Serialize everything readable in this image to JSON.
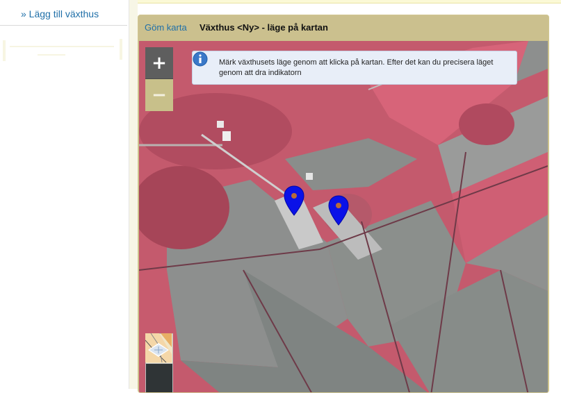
{
  "sidebar": {
    "add_link": "» Lägg till växthus"
  },
  "panel": {
    "hide_map_link": "Göm karta",
    "title": "Växthus <Ny> - läge på kartan"
  },
  "map": {
    "info_text": "Märk växthusets läge genom att klicka på kartan. Efter det kan du precisera läget genom att dra indikatorn",
    "zoom_in_label": "+",
    "zoom_out_label": "−",
    "info_icon": "info-icon",
    "marker_color": "#0a11e8",
    "markers": [
      {
        "name": "greenhouse-marker-1"
      },
      {
        "name": "greenhouse-marker-2"
      }
    ]
  },
  "colors": {
    "panel_header": "#cbc08e",
    "link": "#1f6fa8",
    "field_red": "#c55a6e",
    "field_gray": "#8a8a8a"
  }
}
